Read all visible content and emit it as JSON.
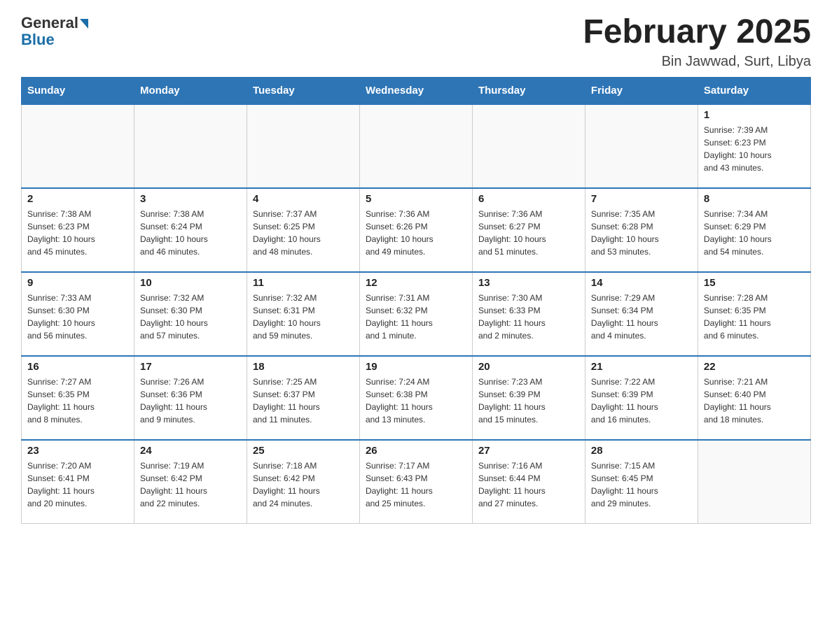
{
  "header": {
    "logo_general": "General",
    "logo_blue": "Blue",
    "month": "February 2025",
    "location": "Bin Jawwad, Surt, Libya"
  },
  "days_of_week": [
    "Sunday",
    "Monday",
    "Tuesday",
    "Wednesday",
    "Thursday",
    "Friday",
    "Saturday"
  ],
  "weeks": [
    {
      "days": [
        {
          "number": "",
          "info": ""
        },
        {
          "number": "",
          "info": ""
        },
        {
          "number": "",
          "info": ""
        },
        {
          "number": "",
          "info": ""
        },
        {
          "number": "",
          "info": ""
        },
        {
          "number": "",
          "info": ""
        },
        {
          "number": "1",
          "info": "Sunrise: 7:39 AM\nSunset: 6:23 PM\nDaylight: 10 hours\nand 43 minutes."
        }
      ]
    },
    {
      "days": [
        {
          "number": "2",
          "info": "Sunrise: 7:38 AM\nSunset: 6:23 PM\nDaylight: 10 hours\nand 45 minutes."
        },
        {
          "number": "3",
          "info": "Sunrise: 7:38 AM\nSunset: 6:24 PM\nDaylight: 10 hours\nand 46 minutes."
        },
        {
          "number": "4",
          "info": "Sunrise: 7:37 AM\nSunset: 6:25 PM\nDaylight: 10 hours\nand 48 minutes."
        },
        {
          "number": "5",
          "info": "Sunrise: 7:36 AM\nSunset: 6:26 PM\nDaylight: 10 hours\nand 49 minutes."
        },
        {
          "number": "6",
          "info": "Sunrise: 7:36 AM\nSunset: 6:27 PM\nDaylight: 10 hours\nand 51 minutes."
        },
        {
          "number": "7",
          "info": "Sunrise: 7:35 AM\nSunset: 6:28 PM\nDaylight: 10 hours\nand 53 minutes."
        },
        {
          "number": "8",
          "info": "Sunrise: 7:34 AM\nSunset: 6:29 PM\nDaylight: 10 hours\nand 54 minutes."
        }
      ]
    },
    {
      "days": [
        {
          "number": "9",
          "info": "Sunrise: 7:33 AM\nSunset: 6:30 PM\nDaylight: 10 hours\nand 56 minutes."
        },
        {
          "number": "10",
          "info": "Sunrise: 7:32 AM\nSunset: 6:30 PM\nDaylight: 10 hours\nand 57 minutes."
        },
        {
          "number": "11",
          "info": "Sunrise: 7:32 AM\nSunset: 6:31 PM\nDaylight: 10 hours\nand 59 minutes."
        },
        {
          "number": "12",
          "info": "Sunrise: 7:31 AM\nSunset: 6:32 PM\nDaylight: 11 hours\nand 1 minute."
        },
        {
          "number": "13",
          "info": "Sunrise: 7:30 AM\nSunset: 6:33 PM\nDaylight: 11 hours\nand 2 minutes."
        },
        {
          "number": "14",
          "info": "Sunrise: 7:29 AM\nSunset: 6:34 PM\nDaylight: 11 hours\nand 4 minutes."
        },
        {
          "number": "15",
          "info": "Sunrise: 7:28 AM\nSunset: 6:35 PM\nDaylight: 11 hours\nand 6 minutes."
        }
      ]
    },
    {
      "days": [
        {
          "number": "16",
          "info": "Sunrise: 7:27 AM\nSunset: 6:35 PM\nDaylight: 11 hours\nand 8 minutes."
        },
        {
          "number": "17",
          "info": "Sunrise: 7:26 AM\nSunset: 6:36 PM\nDaylight: 11 hours\nand 9 minutes."
        },
        {
          "number": "18",
          "info": "Sunrise: 7:25 AM\nSunset: 6:37 PM\nDaylight: 11 hours\nand 11 minutes."
        },
        {
          "number": "19",
          "info": "Sunrise: 7:24 AM\nSunset: 6:38 PM\nDaylight: 11 hours\nand 13 minutes."
        },
        {
          "number": "20",
          "info": "Sunrise: 7:23 AM\nSunset: 6:39 PM\nDaylight: 11 hours\nand 15 minutes."
        },
        {
          "number": "21",
          "info": "Sunrise: 7:22 AM\nSunset: 6:39 PM\nDaylight: 11 hours\nand 16 minutes."
        },
        {
          "number": "22",
          "info": "Sunrise: 7:21 AM\nSunset: 6:40 PM\nDaylight: 11 hours\nand 18 minutes."
        }
      ]
    },
    {
      "days": [
        {
          "number": "23",
          "info": "Sunrise: 7:20 AM\nSunset: 6:41 PM\nDaylight: 11 hours\nand 20 minutes."
        },
        {
          "number": "24",
          "info": "Sunrise: 7:19 AM\nSunset: 6:42 PM\nDaylight: 11 hours\nand 22 minutes."
        },
        {
          "number": "25",
          "info": "Sunrise: 7:18 AM\nSunset: 6:42 PM\nDaylight: 11 hours\nand 24 minutes."
        },
        {
          "number": "26",
          "info": "Sunrise: 7:17 AM\nSunset: 6:43 PM\nDaylight: 11 hours\nand 25 minutes."
        },
        {
          "number": "27",
          "info": "Sunrise: 7:16 AM\nSunset: 6:44 PM\nDaylight: 11 hours\nand 27 minutes."
        },
        {
          "number": "28",
          "info": "Sunrise: 7:15 AM\nSunset: 6:45 PM\nDaylight: 11 hours\nand 29 minutes."
        },
        {
          "number": "",
          "info": ""
        }
      ]
    }
  ]
}
